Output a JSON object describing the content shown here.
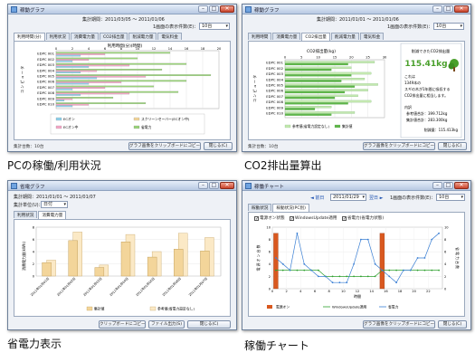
{
  "captions": {
    "pc": "PCの稼働/利用状況",
    "co2": "CO2排出量算出",
    "power": "省電力表示",
    "operation": "稼働チャート"
  },
  "colors": {
    "title_bar": "#c9d7ea",
    "accent_green": "#4aa02c",
    "bar_pink": "#f4a7c7",
    "bar_blue": "#8fd0ea",
    "bar_green": "#9ad37a",
    "bar_orange": "#d9581f",
    "bar_gold": "#f3d59a"
  },
  "w1": {
    "title": "稼動グラフ",
    "period": "集計期間：2011/03/05 ～ 2011/01/06",
    "count_label": "1画面の表示件数(E)：",
    "count_value": "10台",
    "tabs": [
      "利用時間(分)",
      "利用状況",
      "消費電力量",
      "CO2排出量",
      "削減電力量",
      "電気料金"
    ],
    "chart_title": "利用時間(分)(時間)",
    "ticks": [
      "0",
      "2",
      "4",
      "6",
      "8",
      "10",
      "12",
      "14",
      "16",
      "18",
      "20"
    ],
    "pcs": [
      "EDPC 001",
      "EDPC 002",
      "EDPC 003",
      "EDPC 004",
      "EDPC 005",
      "EDPC 006",
      "EDPC 007",
      "EDPC 008",
      "EDPC 009",
      "EDPC 010"
    ],
    "legend": [
      "ECオン",
      "ECオン中",
      "スクリーンセーバー(ECオン中)",
      "省電力"
    ],
    "status": "集計台数：10台",
    "btn_copy": "グラフ画像をクリップボードにコピー(C)",
    "btn_close": "閉じる(C)"
  },
  "w2": {
    "title": "稼動グラフ",
    "period": "集計期間：2011/01/01 ～ 2011/01/06",
    "count_label": "1画面の表示件数(E)：",
    "count_value": "10台",
    "tabs": [
      "利用時間",
      "消費電力量",
      "CO2排出量",
      "削減電力量",
      "電気料金"
    ],
    "chart_title": "CO2排出量(kg)",
    "ticks": [
      "0",
      "5",
      "10",
      "15",
      "20",
      "25",
      "30"
    ],
    "pcs": [
      "EDPC 001",
      "EDPC 002",
      "EDPC 003",
      "EDPC 004",
      "EDPC 005",
      "EDPC 006",
      "EDPC 007",
      "EDPC 008",
      "EDPC 009",
      "EDPC 010"
    ],
    "legend": [
      "参考値(省電力設定なし)",
      "集計値"
    ],
    "side_head": "削減できたCO2排出量",
    "side_value": "115.41kg",
    "side_text": [
      "これは",
      "1349本の",
      "スギの木が1年間に吸収する",
      "CO2排出量に相当します。"
    ],
    "side_detail_head": "内訳",
    "side_detail": [
      "参考値合計：399.712kg",
      "集計値合計：283.300kg"
    ],
    "side_total": "削減量：115.413kg",
    "status": "集計台数：10台",
    "btn_copy": "グラフ画像をクリップボードにコピー(C)",
    "btn_close": "閉じる(C)"
  },
  "w3": {
    "title": "省電グラフ",
    "period": "集計期間：2011/01/01 ～ 2011/01/07",
    "group_label": "集計単位(U)：",
    "group_value": "日付",
    "tabs": [
      "利用状況",
      "消費電力量"
    ],
    "ylabel": "消費電力量(kWh)",
    "dates": [
      "2011年01月01日",
      "2011年01月02日",
      "2011年01月03日",
      "2011年01月04日",
      "2011年01月05日",
      "2011年01月06日",
      "2011年01月07日"
    ],
    "legend": [
      "集計値",
      "参考値(省電力設定なし)"
    ],
    "btn_copy": "クリップボードにコピー(C)",
    "btn_file": "ファイル出力(S)",
    "btn_close": "閉じる(C)"
  },
  "w4": {
    "title": "稼働チャート",
    "prev": "◄ 前日",
    "date": "2011/01/29",
    "next": "翌日 ►",
    "count_label": "1画面の表示件数(E)：",
    "count_value": "10台",
    "tabs": [
      "稼動状況",
      "稼動状況(PC別)"
    ],
    "checks": [
      "電源オン状態",
      "WindowsUpdate適用",
      "省電力(省電力状態)"
    ],
    "hours": [
      "0",
      "2",
      "4",
      "6",
      "8",
      "10",
      "12",
      "14",
      "16",
      "18",
      "20",
      "22"
    ],
    "xlabel": "時間",
    "legend": [
      "電源オン",
      "WindowsUpdate適用",
      "省電力"
    ],
    "btn_copy": "グラフ画像をクリップボードにコピー(C)",
    "btn_close": "閉じる(C)"
  },
  "chart_data": [
    {
      "type": "bar",
      "title": "利用時間(分)(時間)",
      "categories": [
        "EDPC 001",
        "EDPC 002",
        "EDPC 003",
        "EDPC 004",
        "EDPC 005",
        "EDPC 006",
        "EDPC 007",
        "EDPC 008",
        "EDPC 009",
        "EDPC 010"
      ],
      "series": [
        {
          "name": "ECオン",
          "values": [
            14,
            10,
            16,
            13,
            19,
            16,
            12,
            15,
            7,
            11
          ]
        },
        {
          "name": "省電力",
          "values": [
            6,
            4,
            9,
            5,
            11,
            8,
            6,
            9,
            2,
            4
          ]
        },
        {
          "name": "スクリーンセーバー(ECオン中)",
          "values": [
            3,
            2,
            4,
            3,
            5,
            4,
            2,
            3,
            1,
            2
          ]
        }
      ],
      "xlim": [
        0,
        20
      ]
    },
    {
      "type": "bar",
      "title": "CO2排出量(kg)",
      "categories": [
        "EDPC 001",
        "EDPC 002",
        "EDPC 003",
        "EDPC 004",
        "EDPC 005",
        "EDPC 006",
        "EDPC 007",
        "EDPC 008",
        "EDPC 009",
        "EDPC 010"
      ],
      "series": [
        {
          "name": "参考値(省電力設定なし)",
          "values": [
            27,
            20,
            26,
            24,
            28,
            25,
            22,
            26,
            14,
            21
          ]
        },
        {
          "name": "集計値",
          "values": [
            19,
            14,
            20,
            17,
            21,
            18,
            15,
            19,
            9,
            14
          ]
        }
      ],
      "xlim": [
        0,
        30
      ]
    },
    {
      "type": "bar",
      "ylabel": "消費電力量(kWh)",
      "categories": [
        "2011年01月01日",
        "2011年01月02日",
        "2011年01月03日",
        "2011年01月04日",
        "2011年01月05日",
        "2011年01月06日",
        "2011年01月07日"
      ],
      "series": [
        {
          "name": "集計値",
          "values": [
            2.2,
            5.8,
            1.4,
            5.6,
            3.1,
            4.4,
            4.1
          ]
        },
        {
          "name": "参考値(省電力設定なし)",
          "values": [
            2.6,
            7.2,
            1.8,
            6.8,
            4.0,
            7.0,
            6.3
          ]
        }
      ],
      "ylim": [
        0,
        8
      ]
    },
    {
      "type": "bar",
      "xlabel": "時間",
      "x": [
        0,
        1,
        2,
        3,
        4,
        5,
        6,
        7,
        8,
        9,
        10,
        11,
        12,
        13,
        14,
        15,
        16,
        17,
        18,
        19,
        20,
        21,
        22,
        23
      ],
      "series": [
        {
          "name": "電源オン",
          "values": [
            9,
            0,
            0,
            0,
            0,
            0,
            0,
            0,
            0,
            0,
            0,
            0,
            0,
            0,
            0,
            9,
            0,
            0,
            0,
            0,
            0,
            0,
            0,
            0
          ]
        },
        {
          "name": "WindowsUpdate適用",
          "values": [
            3,
            3,
            3,
            3,
            3,
            3,
            3,
            2,
            2,
            2,
            2,
            2,
            2,
            2,
            2,
            3,
            3,
            3,
            3,
            3,
            3,
            3,
            3,
            3
          ]
        },
        {
          "name": "省電力",
          "values": [
            5,
            4,
            3,
            9,
            4,
            3,
            2,
            2,
            1,
            1,
            1,
            4,
            8,
            8,
            4,
            3,
            2,
            1,
            3,
            3,
            5,
            5,
            8,
            9
          ]
        }
      ],
      "ylim": [
        0,
        10
      ]
    }
  ]
}
